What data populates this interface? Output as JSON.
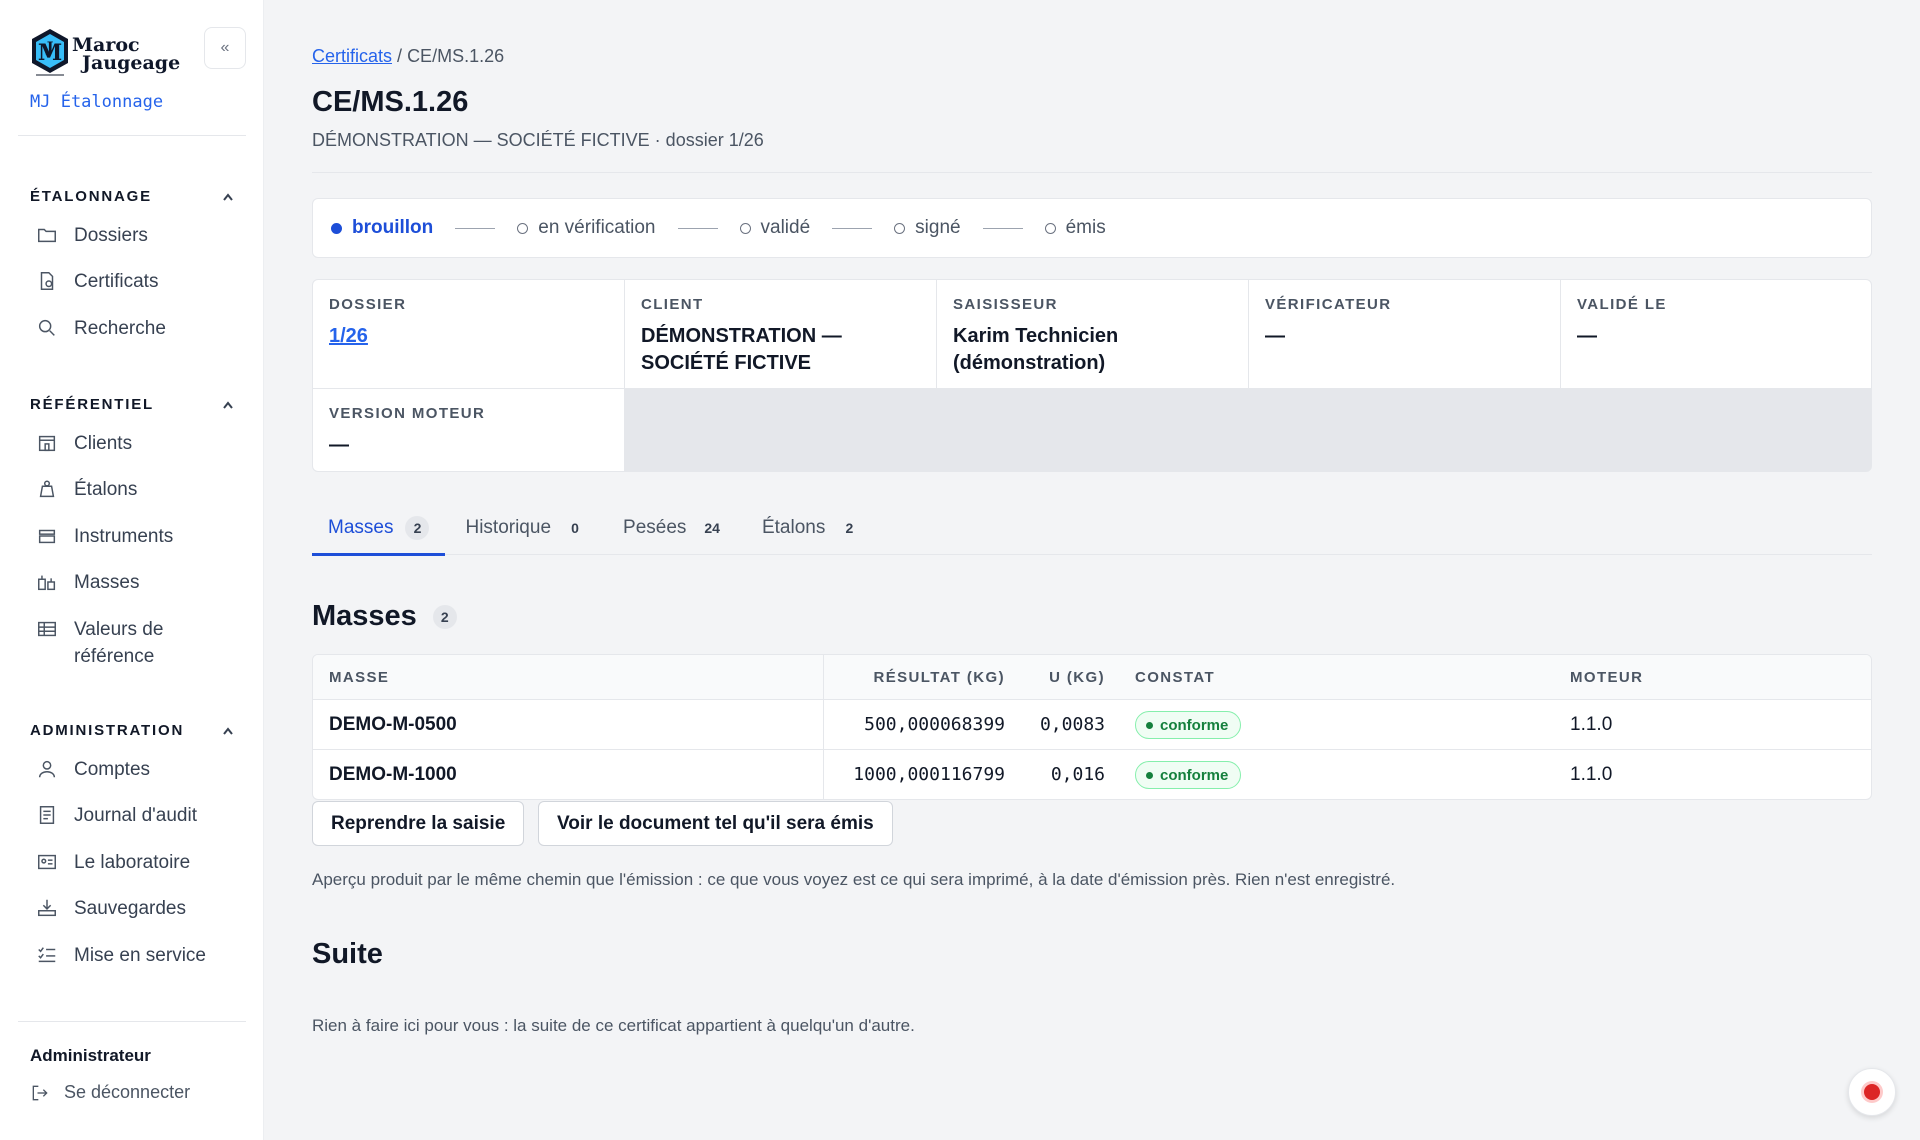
{
  "brand": {
    "logo_line1": "Maroc",
    "logo_line2": "Jaugeage",
    "logo_mark": "MJ",
    "subtitle": "MJ Étalonnage",
    "collapse_label": "«"
  },
  "sidebar": {
    "sections": [
      {
        "title": "ÉTALONNAGE",
        "items": [
          "Dossiers",
          "Certificats",
          "Recherche"
        ]
      },
      {
        "title": "RÉFÉRENTIEL",
        "items": [
          "Clients",
          "Étalons",
          "Instruments",
          "Masses",
          "Valeurs de référence"
        ]
      },
      {
        "title": "ADMINISTRATION",
        "items": [
          "Comptes",
          "Journal d'audit",
          "Le laboratoire",
          "Sauvegardes",
          "Mise en service"
        ]
      }
    ],
    "user": "Administrateur",
    "logout": "Se déconnecter"
  },
  "breadcrumb": {
    "link": "Certificats",
    "separator": "/",
    "current": "CE/MS.1.26"
  },
  "page": {
    "title": "CE/MS.1.26",
    "subtitle": "DÉMONSTRATION — SOCIÉTÉ FICTIVE · dossier 1/26"
  },
  "workflow": {
    "steps": [
      "brouillon",
      "en vérification",
      "validé",
      "signé",
      "émis"
    ],
    "active": "brouillon"
  },
  "info": {
    "dossier_label": "DOSSIER",
    "dossier_value": "1/26",
    "client_label": "CLIENT",
    "client_value": "DÉMONSTRATION — SOCIÉTÉ FICTIVE",
    "saisisseur_label": "SAISISSEUR",
    "saisisseur_value": "Karim Technicien (démonstration)",
    "verificateur_label": "VÉRIFICATEUR",
    "verificateur_value": "—",
    "valide_label": "VALIDÉ LE",
    "valide_value": "—",
    "moteur_label": "VERSION MOTEUR",
    "moteur_value": "—"
  },
  "tabs": [
    {
      "label": "Masses",
      "count": "2"
    },
    {
      "label": "Historique",
      "count": "0"
    },
    {
      "label": "Pesées",
      "count": "24"
    },
    {
      "label": "Étalons",
      "count": "2"
    }
  ],
  "masses": {
    "title": "Masses",
    "count": "2",
    "headers": {
      "masse": "MASSE",
      "resultat": "RÉSULTAT (KG)",
      "u": "U (KG)",
      "constat": "CONSTAT",
      "moteur": "MOTEUR"
    },
    "rows": [
      {
        "masse": "DEMO-M-0500",
        "resultat": "500,000068399",
        "u": "0,0083",
        "constat": "conforme",
        "moteur": "1.1.0"
      },
      {
        "masse": "DEMO-M-1000",
        "resultat": "1000,000116799",
        "u": "0,016",
        "constat": "conforme",
        "moteur": "1.1.0"
      }
    ]
  },
  "actions": {
    "resume": "Reprendre la saisie",
    "preview": "Voir le document tel qu'il sera émis"
  },
  "preview_note": "Aperçu produit par le même chemin que l'émission : ce que vous voyez est ce qui sera imprimé, à la date d'émission près. Rien n'est enregistré.",
  "suite": {
    "title": "Suite",
    "text": "Rien à faire ici pour vous : la suite de ce certificat appartient à quelqu'un d'autre."
  },
  "colors": {
    "accent": "#1d4ed8",
    "link": "#2563eb",
    "success": "#15803d",
    "record": "#dc2626"
  }
}
